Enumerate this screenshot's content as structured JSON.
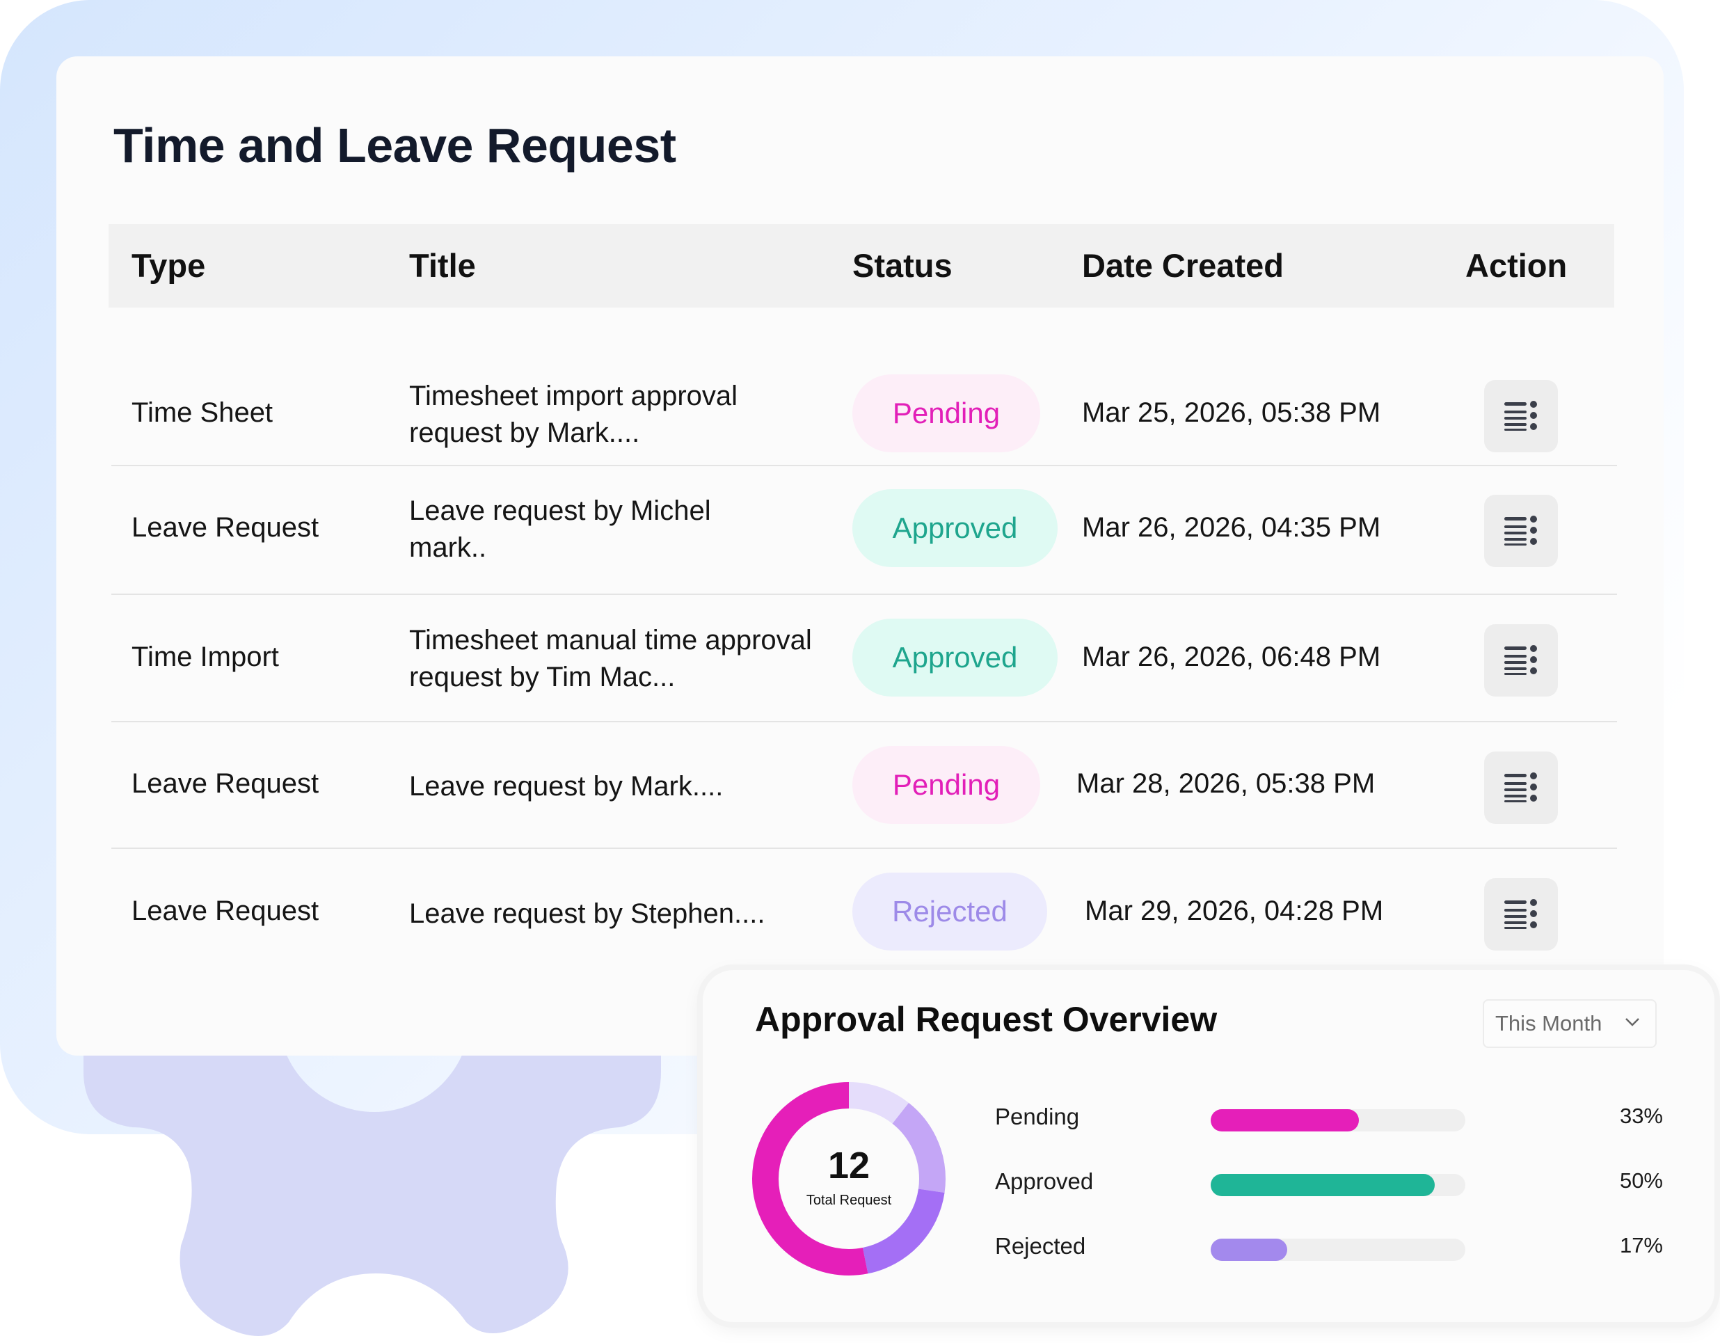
{
  "page_title": "Time and Leave Request",
  "table": {
    "headers": [
      "Type",
      "Title",
      "Status",
      "Date Created",
      "Action"
    ],
    "rows": [
      {
        "type": "Time Sheet",
        "title_line1": "Timesheet import approval",
        "title_line2": "request by Mark....",
        "status": "Pending",
        "date": "Mar 25, 2026, 05:38 PM"
      },
      {
        "type": "Leave Request",
        "title_line1": "Leave request by Michel",
        "title_line2": "mark..",
        "status": "Approved",
        "date": "Mar 26, 2026, 04:35 PM"
      },
      {
        "type": "Time Import",
        "title_line1": "Timesheet manual time approval",
        "title_line2": "request by Tim Mac...",
        "status": "Approved",
        "date": "Mar 26, 2026, 06:48 PM"
      },
      {
        "type": "Leave Request",
        "title_line1": "Leave request by Mark....",
        "title_line2": "",
        "status": "Pending",
        "date": "Mar 28, 2026, 05:38 PM"
      },
      {
        "type": "Leave Request",
        "title_line1": "Leave request by Stephen....",
        "title_line2": "",
        "status": "Rejected",
        "date": "Mar 29, 2026, 04:28 PM"
      }
    ],
    "action_icon": "list-menu-icon"
  },
  "overview": {
    "title": "Approval Request Overview",
    "period_select": "This Month",
    "total": "12",
    "total_label": "Total Request",
    "items": [
      {
        "label": "Pending",
        "percent": "33%",
        "fraction": 0.33,
        "color": "#e51fb9"
      },
      {
        "label": "Approved",
        "percent": "50%",
        "fraction": 0.5,
        "color": "#1fb597"
      },
      {
        "label": "Rejected",
        "percent": "17%",
        "fraction": 0.17,
        "color": "#a389ed"
      }
    ]
  },
  "colors": {
    "accent_pending": "#e51fb9",
    "accent_approved": "#1fb597",
    "accent_rejected": "#a389ed",
    "donut_light": "#e4dcfb",
    "donut_mid": "#c5a8f6",
    "donut_purple": "#a46ff5",
    "gear": "#d5d9f7"
  }
}
